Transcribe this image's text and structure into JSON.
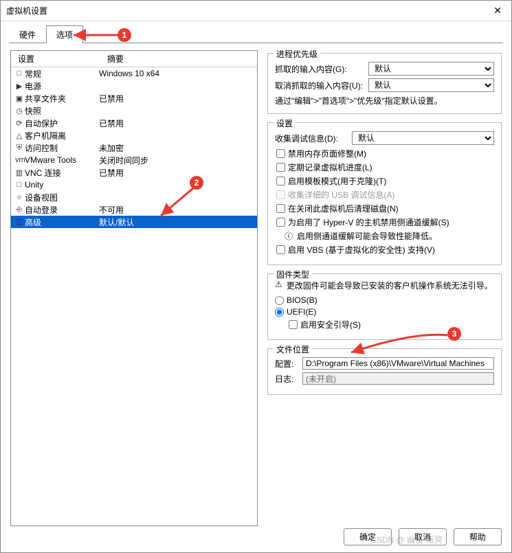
{
  "window": {
    "title": "虚拟机设置"
  },
  "tabs": {
    "hardware": "硬件",
    "options": "选项"
  },
  "list": {
    "header": {
      "setting": "设置",
      "summary": "摘要"
    },
    "rows": [
      {
        "icon": "□",
        "name": "常规",
        "summary": "Windows 10 x64"
      },
      {
        "icon": "▶",
        "name": "电源",
        "summary": "",
        "iconClass": "play-icon"
      },
      {
        "icon": "▣",
        "name": "共享文件夹",
        "summary": "已禁用"
      },
      {
        "icon": "◷",
        "name": "快照",
        "summary": ""
      },
      {
        "icon": "⟳",
        "name": "自动保护",
        "summary": "已禁用"
      },
      {
        "icon": "△",
        "name": "客户机隔离",
        "summary": ""
      },
      {
        "icon": "⛨",
        "name": "访问控制",
        "summary": "未加密"
      },
      {
        "icon": "vm",
        "name": "VMware Tools",
        "summary": "关闭时间同步"
      },
      {
        "icon": "▥",
        "name": "VNC 连接",
        "summary": "已禁用"
      },
      {
        "icon": "□",
        "name": "Unity",
        "summary": ""
      },
      {
        "icon": "☼",
        "name": "设备视图",
        "summary": ""
      },
      {
        "icon": "⎆",
        "name": "自动登录",
        "summary": "不可用"
      },
      {
        "icon": "☲",
        "name": "高级",
        "summary": "默认/默认",
        "selected": true
      }
    ]
  },
  "priority": {
    "title": "进程优先级",
    "grabbed": "抓取的输入内容(G):",
    "ungrabbed": "取消抓取的输入内容(U):",
    "default_opt": "默认",
    "note": "通过\"编辑\">\"首选项\">\"优先级\"指定默认设置。"
  },
  "settings": {
    "title": "设置",
    "debug_label": "收集调试信息(D):",
    "debug_default": "默认",
    "chk_memtrim": "禁用内存页面修整(M)",
    "chk_log": "定期记录虚拟机进度(L)",
    "chk_template": "启用模板模式(用于克隆)(T)",
    "chk_usb": "收集详细的 USB 调试信息(A)",
    "chk_clean": "在关闭此虚拟机后清理磁盘(N)",
    "chk_hyperv": "为启用了 Hyper-V 的主机禁用侧通道缓解(S)",
    "info_side": "启用侧通道缓解可能会导致性能降低。",
    "chk_vbs": "启用 VBS (基于虚拟化的安全性) 支持(V)"
  },
  "firmware": {
    "title": "固件类型",
    "warn": "更改固件可能会导致已安装的客户机操作系统无法引导。",
    "bios": "BIOS(B)",
    "uefi": "UEFI(E)",
    "secureboot": "启用安全引导(S)"
  },
  "fileloc": {
    "title": "文件位置",
    "config": "配置:",
    "config_val": "D:\\Program Files (x86)\\VMware\\Virtual Machines",
    "log": "日志:",
    "log_val": "(未开启)"
  },
  "footer": {
    "ok": "确定",
    "cancel": "取消",
    "help": "帮助"
  },
  "watermark": "CSDN @ 幽反·叛冥",
  "markers": {
    "m1": "1",
    "m2": "2",
    "m3": "3"
  }
}
